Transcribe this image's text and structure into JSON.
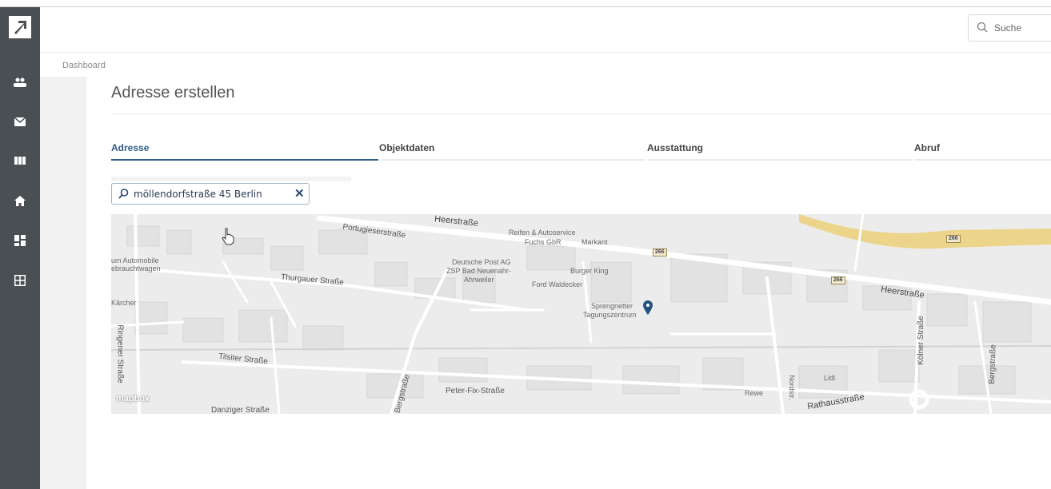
{
  "header": {
    "search_placeholder": "Suche"
  },
  "sidebar": {
    "items": [
      {
        "icon": "users-icon"
      },
      {
        "icon": "mail-icon"
      },
      {
        "icon": "columns-icon"
      },
      {
        "icon": "home-icon"
      },
      {
        "icon": "dashboard-icon"
      },
      {
        "icon": "grid-icon"
      }
    ]
  },
  "breadcrumb": "Dashboard",
  "page": {
    "title": "Adresse erstellen"
  },
  "tabs": [
    {
      "label": "Adresse",
      "active": true
    },
    {
      "label": "Objektdaten",
      "active": false
    },
    {
      "label": "Ausstattung",
      "active": false
    },
    {
      "label": "Abruf",
      "active": false
    }
  ],
  "address_input": {
    "value": "möllendorfstraße 45 Berlin",
    "clear_glyph": "✕"
  },
  "map": {
    "attribution": "mapbox",
    "labels": {
      "heerstrasse_top": "Heerstraße",
      "portugieser": "Portugieserstraße",
      "reifen": "Reifen & Autoservice",
      "fuchs": "Fuchs GbR",
      "markant": "Markant",
      "automobile1": "um Automobile",
      "automobile2": "ebrauchtwagen",
      "deutsche_post1": "Deutsche Post AG",
      "deutsche_post2": "ZSP Bad Neuenahr-",
      "deutsche_post3": "Ahrweiler",
      "burger_king": "Burger King",
      "ford": "Ford Waldecker",
      "thurgauer": "Thurgauer Straße",
      "karcher": "Kärcher",
      "sprengnetter1": "Sprengnetter",
      "sprengnetter2": "Tagungszentrum",
      "heerstrasse_right": "Heerstraße",
      "ringener": "Ringener Straße",
      "tilsiter": "Tilsiter Straße",
      "peter_fix": "Peter-Fix-Straße",
      "bergstrasse_left": "Bergstraße",
      "rewe": "Rewe",
      "nordstr": "Nordstr.",
      "lidl": "Lidl",
      "rathausstrasse": "Rathausstraße",
      "koelner": "Kölner Straße",
      "bergstrasse_right": "Bergstraße",
      "danziger": "Danziger Straße"
    },
    "shields": [
      "266",
      "266",
      "266"
    ]
  }
}
